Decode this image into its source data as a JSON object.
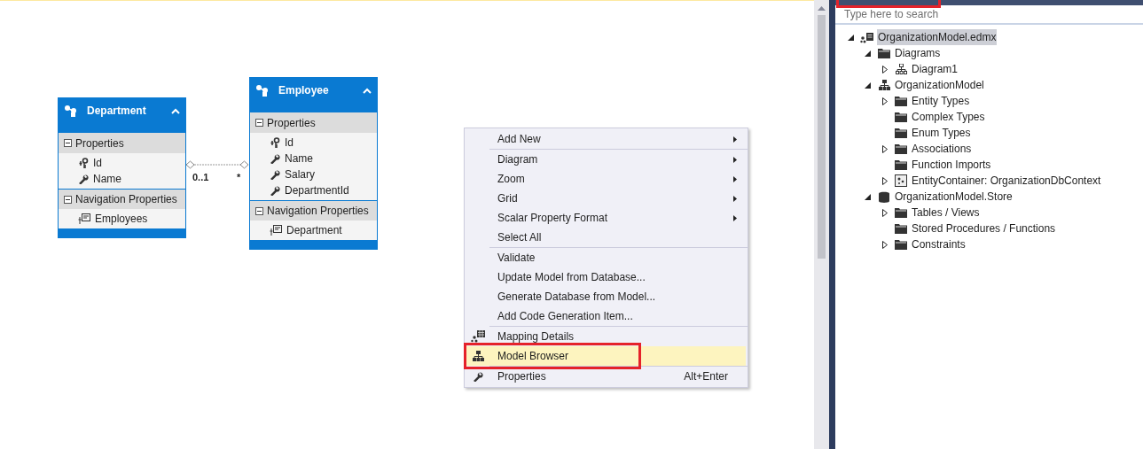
{
  "diagram": {
    "entities": [
      {
        "name": "Department",
        "collapsed": false,
        "sections": [
          {
            "title": "Properties",
            "expanded": true,
            "items": [
              {
                "name": "Id",
                "kind": "key"
              },
              {
                "name": "Name",
                "kind": "scalar"
              }
            ]
          },
          {
            "title": "Navigation Properties",
            "expanded": true,
            "items": [
              {
                "name": "Employees",
                "kind": "navigation"
              }
            ]
          }
        ]
      },
      {
        "name": "Employee",
        "collapsed": false,
        "sections": [
          {
            "title": "Properties",
            "expanded": true,
            "items": [
              {
                "name": "Id",
                "kind": "key"
              },
              {
                "name": "Name",
                "kind": "scalar"
              },
              {
                "name": "Salary",
                "kind": "scalar"
              },
              {
                "name": "DepartmentId",
                "kind": "scalar"
              }
            ]
          },
          {
            "title": "Navigation Properties",
            "expanded": true,
            "items": [
              {
                "name": "Department",
                "kind": "navigation"
              }
            ]
          }
        ]
      }
    ],
    "association": {
      "from_multiplicity": "0..1",
      "to_multiplicity": "*"
    }
  },
  "context_menu": {
    "groups": [
      [
        {
          "label": "Add New",
          "submenu": true,
          "selected": false
        }
      ],
      [
        {
          "label": "Diagram",
          "submenu": true,
          "selected": false
        },
        {
          "label": "Zoom",
          "submenu": true,
          "selected": false
        },
        {
          "label": "Grid",
          "submenu": true,
          "selected": false
        },
        {
          "label": "Scalar Property Format",
          "submenu": true,
          "selected": false
        },
        {
          "label": "Select All",
          "selected": false
        }
      ],
      [
        {
          "label": "Validate",
          "selected": false
        },
        {
          "label": "Update Model from Database...",
          "selected": false
        },
        {
          "label": "Generate Database from Model...",
          "selected": false
        },
        {
          "label": "Add Code Generation Item...",
          "selected": false
        }
      ],
      [
        {
          "label": "Mapping Details",
          "kind": "mapping",
          "selected": false
        },
        {
          "label": "Model Browser",
          "kind": "hierarchy",
          "selected": true,
          "annotated": true
        }
      ],
      [
        {
          "label": "Properties",
          "kind": "wrench",
          "shortcut": "Alt+Enter",
          "selected": false
        }
      ]
    ]
  },
  "model_browser": {
    "header_annotated": true,
    "search": {
      "placeholder": "Type here to search"
    },
    "tree": [
      {
        "label": "OrganizationModel.edmx",
        "kind": "edmx",
        "expanded": true,
        "selected": true,
        "children": [
          {
            "label": "Diagrams",
            "kind": "folder",
            "expanded": true,
            "children": [
              {
                "label": "Diagram1",
                "kind": "diagram",
                "expanded": false
              }
            ]
          },
          {
            "label": "OrganizationModel",
            "kind": "hierarchy",
            "expanded": true,
            "children": [
              {
                "label": "Entity Types",
                "kind": "folder",
                "expanded": false
              },
              {
                "label": "Complex Types",
                "kind": "folder"
              },
              {
                "label": "Enum Types",
                "kind": "folder"
              },
              {
                "label": "Associations",
                "kind": "folder",
                "expanded": false
              },
              {
                "label": "Function Imports",
                "kind": "folder"
              },
              {
                "label": "EntityContainer: OrganizationDbContext",
                "kind": "container",
                "expanded": false
              }
            ]
          },
          {
            "label": "OrganizationModel.Store",
            "kind": "database",
            "expanded": true,
            "children": [
              {
                "label": "Tables / Views",
                "kind": "folder",
                "expanded": false
              },
              {
                "label": "Stored Procedures / Functions",
                "kind": "folder"
              },
              {
                "label": "Constraints",
                "kind": "folder",
                "expanded": false
              }
            ]
          }
        ]
      }
    ]
  }
}
